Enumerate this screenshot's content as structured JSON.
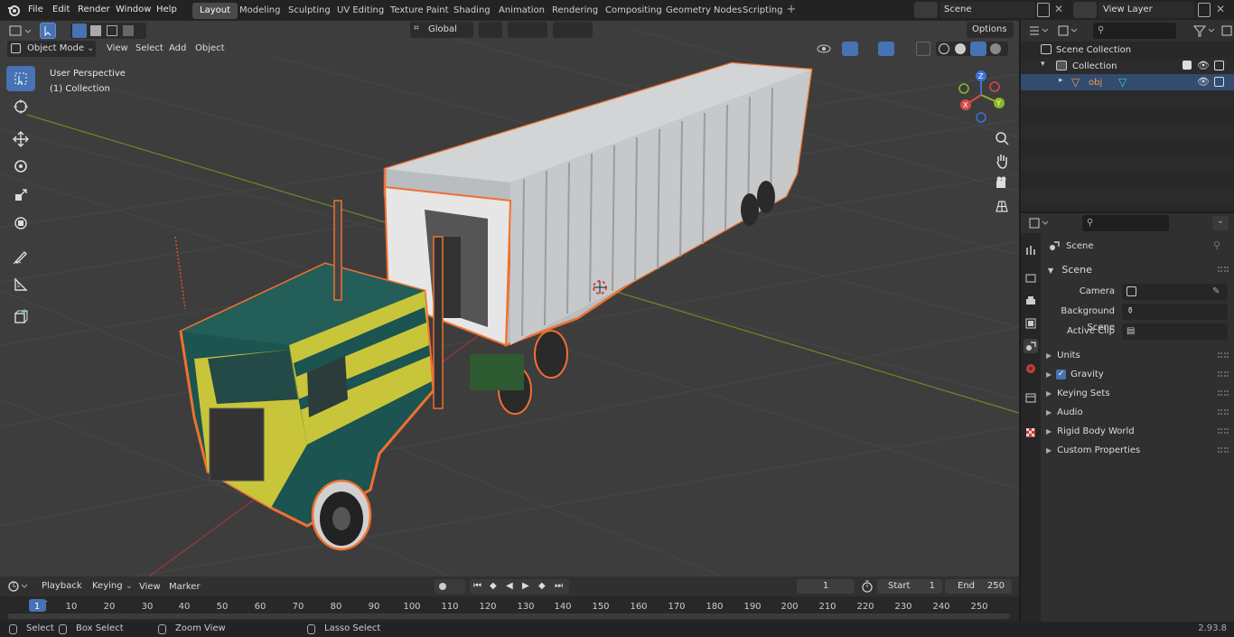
{
  "menu": [
    "File",
    "Edit",
    "Render",
    "Window",
    "Help"
  ],
  "workspaces": [
    "Layout",
    "Modeling",
    "Sculpting",
    "UV Editing",
    "Texture Paint",
    "Shading",
    "Animation",
    "Rendering",
    "Compositing",
    "Geometry Nodes",
    "Scripting"
  ],
  "scene_name": "Scene",
  "view_layer_name": "View Layer",
  "header": {
    "mode": "Object Mode",
    "menus": [
      "View",
      "Select",
      "Add",
      "Object"
    ],
    "orientation": "Global",
    "options": "Options"
  },
  "viewport": {
    "perspective": "User Perspective",
    "collection": "(1) Collection"
  },
  "outliner": {
    "scene_collection": "Scene Collection",
    "collection": "Collection",
    "object": "obj"
  },
  "properties": {
    "title": "Scene",
    "section": "Scene",
    "fields": [
      {
        "label": "Camera"
      },
      {
        "label": "Background Scene"
      },
      {
        "label": "Active Clip"
      }
    ],
    "panels": [
      "Units",
      "Gravity",
      "Keying Sets",
      "Audio",
      "Rigid Body World",
      "Custom Properties"
    ]
  },
  "timeline": {
    "menus": [
      "Playback",
      "Keying",
      "View",
      "Marker"
    ],
    "current": "1",
    "start_label": "Start",
    "start": "1",
    "end_label": "End",
    "end": "250",
    "ticks": [
      "1",
      "10",
      "20",
      "30",
      "40",
      "50",
      "60",
      "70",
      "80",
      "90",
      "100",
      "110",
      "120",
      "130",
      "140",
      "150",
      "160",
      "170",
      "180",
      "190",
      "200",
      "210",
      "220",
      "230",
      "240",
      "250"
    ]
  },
  "status": {
    "select": "Select",
    "box_select": "Box Select",
    "zoom": "Zoom View",
    "lasso": "Lasso Select",
    "version": "2.93.8"
  },
  "colors": {
    "accent": "#4772b3",
    "outline": "#f07030",
    "bg": "#303030"
  }
}
